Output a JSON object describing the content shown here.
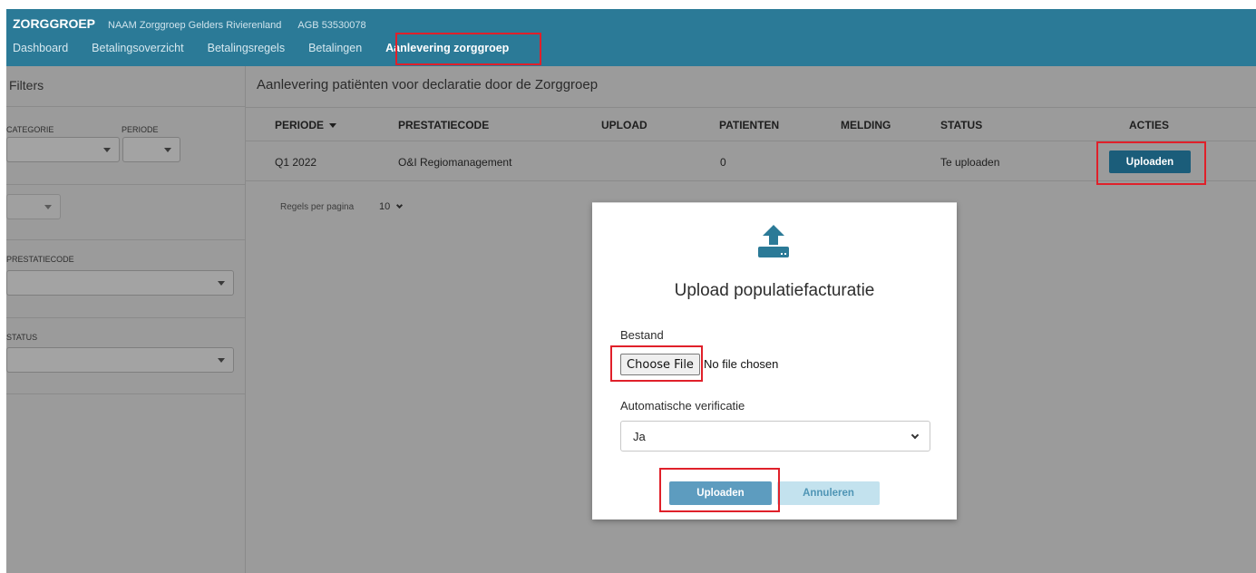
{
  "header": {
    "brand": "ZORGGROEP",
    "naam_label": "NAAM",
    "naam_value": "Zorggroep Gelders Rivierenland",
    "agb_label": "AGB",
    "agb_value": "53530078",
    "nav": [
      "Dashboard",
      "Betalingsoverzicht",
      "Betalingsregels",
      "Betalingen",
      "Aanlevering zorggroep"
    ],
    "active_nav": "Aanlevering zorggroep",
    "bg_color": "#2b7a97"
  },
  "sidebar": {
    "title": "Filters",
    "categorie_label": "CATEGORIE",
    "periode_label": "PERIODE",
    "prestatiecode_label": "PRESTATIECODE",
    "status_label": "STATUS"
  },
  "main": {
    "title": "Aanlevering patiënten voor declaratie door de Zorggroep",
    "columns": [
      "PERIODE",
      "PRESTATIECODE",
      "UPLOAD",
      "PATIENTEN",
      "MELDING",
      "STATUS",
      "ACTIES"
    ],
    "rows": [
      {
        "periode": "Q1 2022",
        "prestatiecode": "O&I Regiomanagement",
        "upload": "",
        "patienten": "0",
        "melding": "",
        "status": "Te uploaden",
        "action": "Uploaden"
      }
    ],
    "pager_label": "Regels per pagina",
    "pager_value": "10"
  },
  "modal": {
    "icon": "upload-icon",
    "title": "Upload populatiefacturatie",
    "file_label": "Bestand",
    "file_button": "Choose File",
    "file_status": "No file chosen",
    "verify_label": "Automatische verificatie",
    "verify_value": "Ja",
    "submit_label": "Uploaden",
    "cancel_label": "Annuleren",
    "primary_color": "#5d9cbf"
  }
}
